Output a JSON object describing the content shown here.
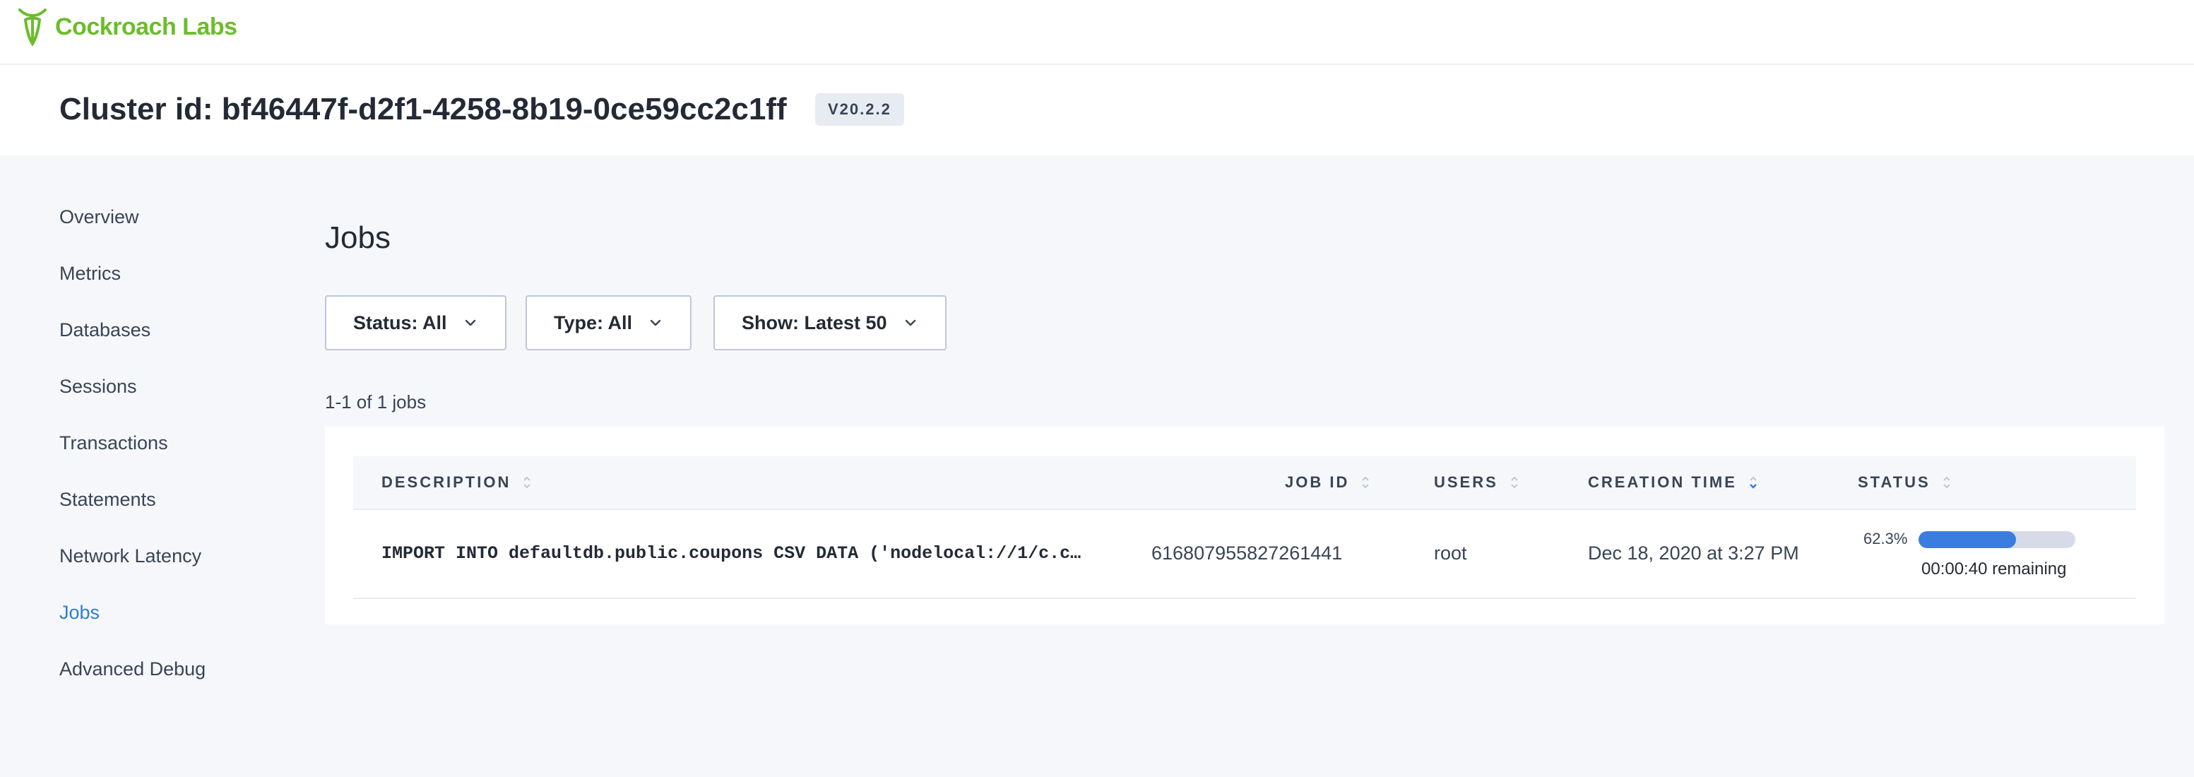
{
  "brand": {
    "name": "Cockroach Labs",
    "color": "#6bbd2a",
    "logo_icon": "cockroach-logo-icon"
  },
  "cluster": {
    "label": "Cluster id: bf46447f-d2f1-4258-8b19-0ce59cc2c1ff",
    "version": "V20.2.2"
  },
  "sidebar": {
    "items": [
      {
        "label": "Overview"
      },
      {
        "label": "Metrics"
      },
      {
        "label": "Databases"
      },
      {
        "label": "Sessions"
      },
      {
        "label": "Transactions"
      },
      {
        "label": "Statements"
      },
      {
        "label": "Network Latency"
      },
      {
        "label": "Jobs",
        "active": true
      },
      {
        "label": "Advanced Debug"
      }
    ],
    "active_color": "#2e7bde"
  },
  "page": {
    "title": "Jobs"
  },
  "filters": {
    "status": "Status: All",
    "type": "Type: All",
    "show": "Show: Latest 50"
  },
  "summary": {
    "count_text": "1-1 of 1 jobs"
  },
  "table": {
    "columns": [
      {
        "label": "DESCRIPTION"
      },
      {
        "label": "JOB ID"
      },
      {
        "label": "USERS"
      },
      {
        "label": "CREATION TIME",
        "sorted": "desc"
      },
      {
        "label": "STATUS"
      }
    ],
    "rows": [
      {
        "description": "IMPORT INTO defaultdb.public.coupons CSV DATA ('nodelocal://1/c.c…",
        "job_id": "616807955827261441",
        "user": "root",
        "creation_time": "Dec 18, 2020 at 3:27 PM",
        "progress_label": "62.3%",
        "progress_fraction": 0.623,
        "remaining": "00:00:40 remaining"
      }
    ]
  },
  "colors": {
    "progress": "#3a7de1",
    "track": "#d6dbe7",
    "sort_active": "#2e7bde"
  }
}
